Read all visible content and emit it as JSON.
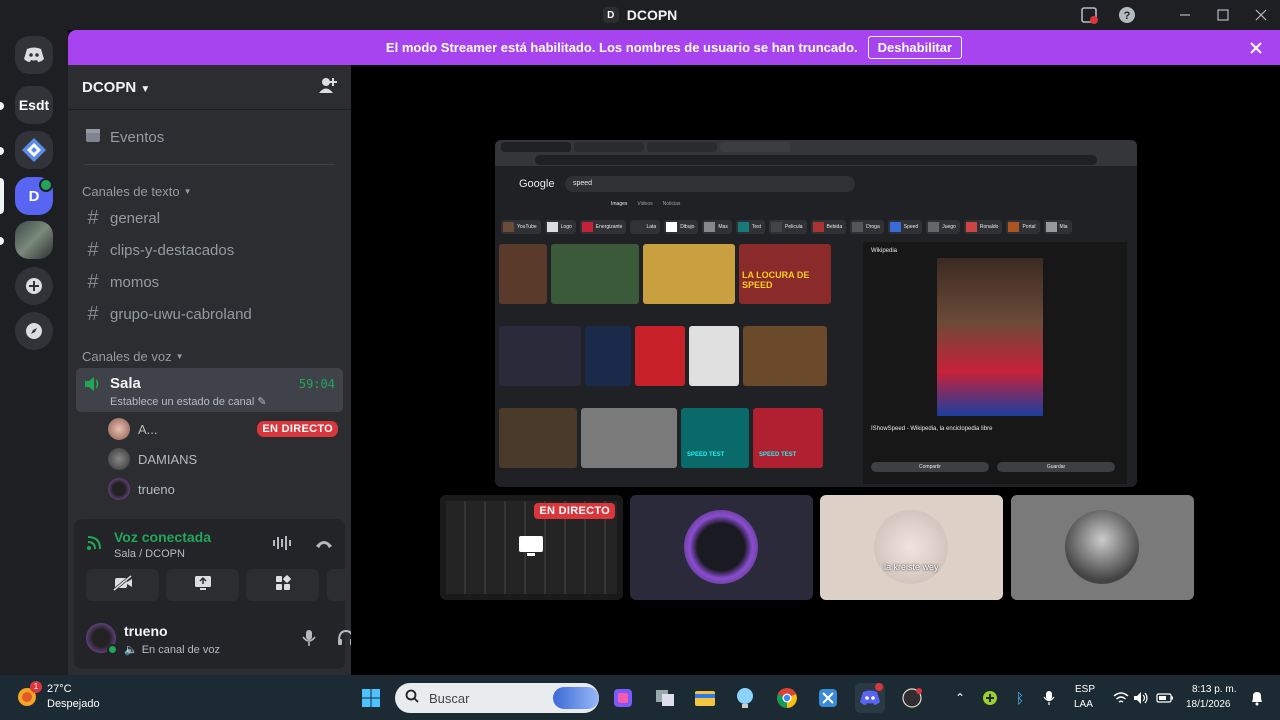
{
  "window": {
    "title": "DCOPN",
    "logo_letter": "D"
  },
  "guilds": [
    {
      "label": "Esdt"
    },
    {
      "label": "D"
    }
  ],
  "banner": {
    "message": "El modo Streamer está habilitado. Los nombres de usuario se han truncado.",
    "button": "Deshabilitar"
  },
  "server": {
    "name": "DCOPN",
    "events_label": "Eventos"
  },
  "text_category": "Canales de texto",
  "text_channels": [
    {
      "name": "general"
    },
    {
      "name": "clips-y-destacados"
    },
    {
      "name": "momos"
    },
    {
      "name": "grupo-uwu-cabroland"
    }
  ],
  "voice_category": "Canales de voz",
  "voice_channel": {
    "name": "Sala",
    "timer": "59:04",
    "status_prompt": "Establece un estado de canal"
  },
  "voice_users": [
    {
      "name": "A...",
      "badge": "EN DIRECTO"
    },
    {
      "name": "DAMIANS"
    },
    {
      "name": "trueno"
    }
  ],
  "voice_panel": {
    "status": "Voz conectada",
    "location": "Sala / DCOPN"
  },
  "user": {
    "name": "trueno",
    "status": "En canal de voz"
  },
  "stream": {
    "browser_search": "speed",
    "google_logo": "Google",
    "tabs": [
      "Images",
      "Videos",
      "Noticias"
    ],
    "chips": [
      "YouTube",
      "Logo",
      "Energizante",
      "Lata",
      "Dibujo",
      "Mas",
      "Test",
      "Pelicula",
      "Bebida",
      "Droga",
      "Speed",
      "Juego",
      "Ronaldo",
      "Portal",
      "Mia"
    ],
    "thumb_label": "LA LOCURA DE SPEED",
    "gauge_label": "SPEED TEST",
    "preview_source": "Wikipedia",
    "preview_title": "IShowSpeed - Wikipedia, la enciclopedia libre",
    "preview_btn1": "Compartir",
    "preview_btn2": "Guardar"
  },
  "tiles": [
    {
      "badge": "EN DIRECTO"
    },
    {
      "name": "avatar"
    },
    {
      "caption": "la kreiste wey"
    },
    {
      "name": "avatar"
    }
  ],
  "taskbar": {
    "temp": "27°C",
    "weather": "Despejado",
    "weather_badge": "1",
    "search_placeholder": "Buscar",
    "lang1": "ESP",
    "lang2": "LAA",
    "time": "8:13 p. m.",
    "date": "18/1/2026"
  }
}
